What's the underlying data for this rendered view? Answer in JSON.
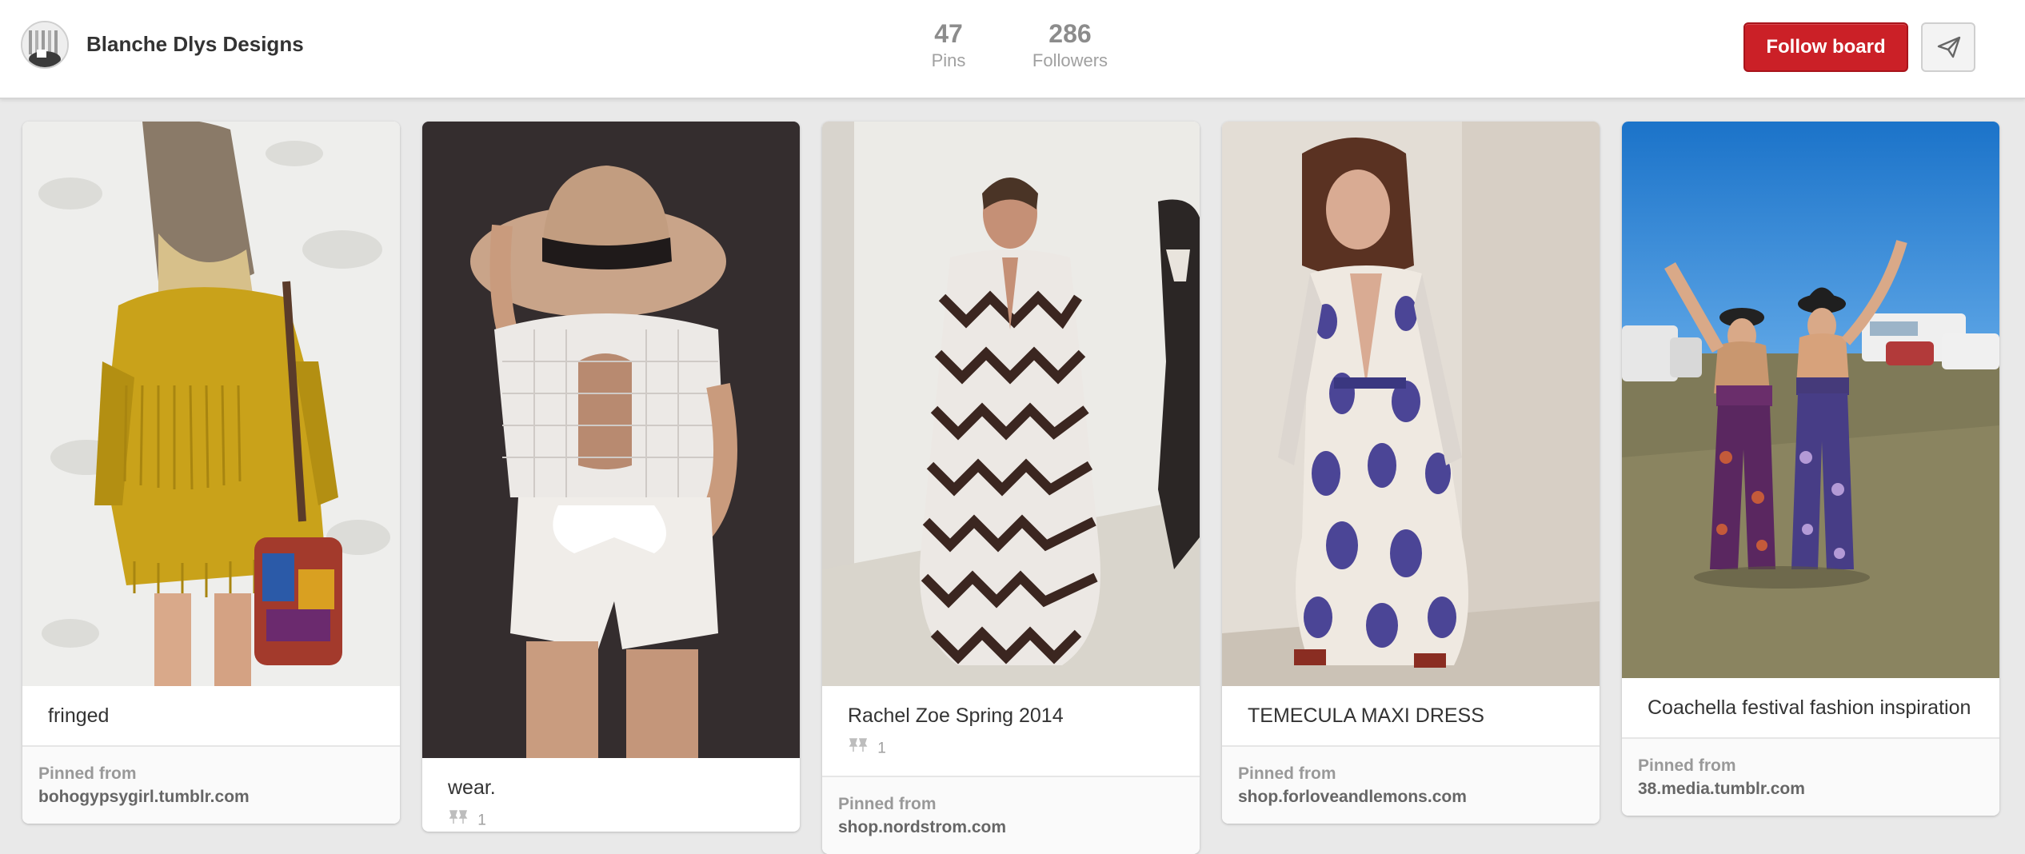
{
  "header": {
    "board_name": "Blanche Dlys Designs",
    "pins_count": "47",
    "pins_label": "Pins",
    "followers_count": "286",
    "followers_label": "Followers",
    "follow_button_label": "Follow board",
    "accent_color": "#cb2027"
  },
  "pins": [
    {
      "description": "fringed",
      "repin_count": "",
      "pinned_from_label": "Pinned from",
      "source": "bohogypsygirl.tumblr.com"
    },
    {
      "description": "wear.",
      "repin_count": "1",
      "pinned_from_label": "",
      "source": ""
    },
    {
      "description": "Rachel Zoe Spring 2014",
      "repin_count": "1",
      "pinned_from_label": "Pinned from",
      "source": "shop.nordstrom.com"
    },
    {
      "description": "TEMECULA MAXI DRESS",
      "repin_count": "",
      "pinned_from_label": "Pinned from",
      "source": "shop.forloveandlemons.com"
    },
    {
      "description": "Coachella festival fashion inspiration",
      "repin_count": "",
      "pinned_from_label": "Pinned from",
      "source": "38.media.tumblr.com"
    }
  ]
}
